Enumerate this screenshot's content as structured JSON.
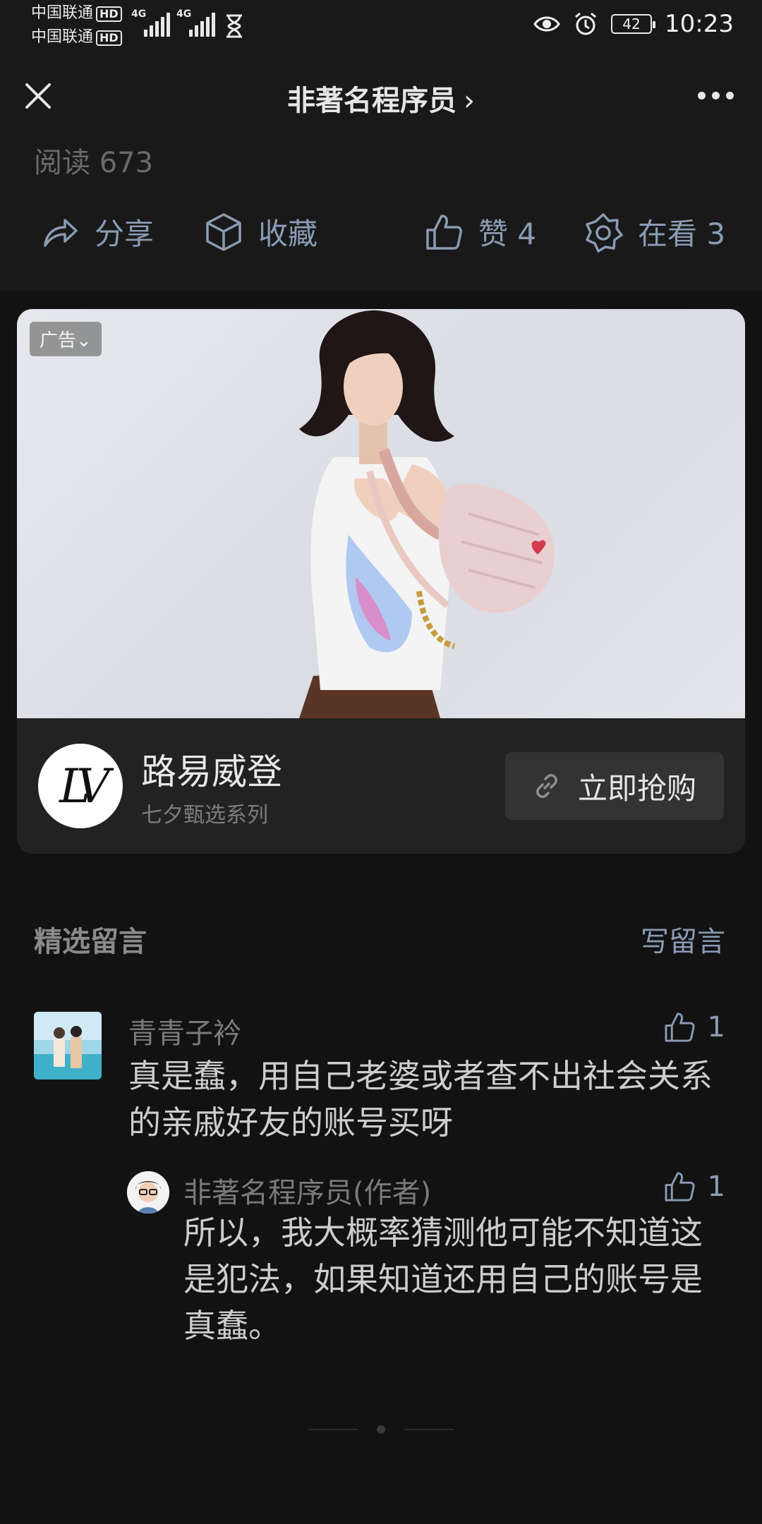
{
  "status_bar": {
    "carrier1": "中国联通",
    "carrier2": "中国联通",
    "hd": "HD",
    "net1": "4G",
    "net2": "4G",
    "battery": "42",
    "time": "10:23"
  },
  "header": {
    "title": "非著名程序员",
    "title_chevron": "›"
  },
  "article": {
    "read_count": "阅读 673"
  },
  "actions": {
    "share": "分享",
    "favorite": "收藏",
    "like": "赞 4",
    "watching": "在看 3"
  },
  "ad": {
    "tag": "广告",
    "tag_chevron": "⌄",
    "brand_logo": "LV",
    "brand_name": "路易威登",
    "brand_sub": "七夕甄选系列",
    "buy_label": "立即抢购"
  },
  "comments_section": {
    "title": "精选留言",
    "write": "写留言"
  },
  "comments": [
    {
      "name": "青青子衿",
      "likes": "1",
      "text": "真是蠢，用自己老婆或者查不出社会关系的亲戚好友的账号买呀",
      "reply": {
        "name": "非著名程序员(作者)",
        "likes": "1",
        "text": "所以，我大概率猜测他可能不知道这是犯法，如果知道还用自己的账号是真蠢。"
      }
    }
  ],
  "colors": {
    "background": "#121212",
    "surface": "#191919",
    "card": "#222222",
    "accent": "#8a9bb4"
  }
}
